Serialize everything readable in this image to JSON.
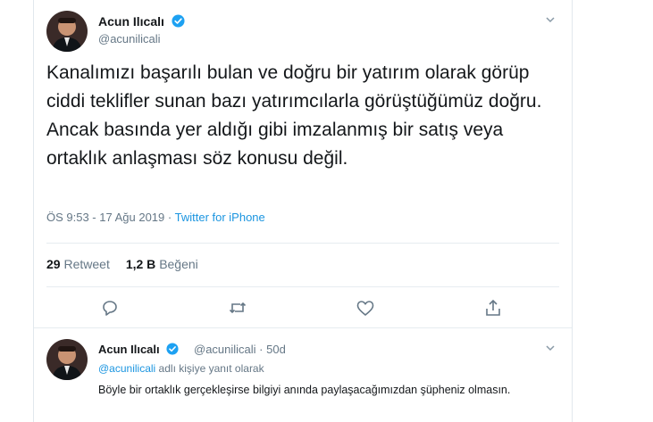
{
  "tweet": {
    "author_name": "Acun Ilıcalı",
    "author_handle": "@acunilicali",
    "text": "Kanalımızı başarılı bulan ve doğru bir yatırım olarak görüp ciddi teklifler sunan bazı yatırımcılarla görüştüğümüz doğru. Ancak basında yer aldığı gibi imzalanmış bir satış veya ortaklık anlaşması söz konusu değil.",
    "timestamp": "ÖS 9:53 - 17 Ağu 2019",
    "separator": " · ",
    "source": "Twitter for iPhone",
    "retweets_count": "29",
    "retweets_label": "Retweet",
    "likes_count": "1,2 B",
    "likes_label": "Beğeni"
  },
  "actions": [
    {
      "icon": "reply-icon"
    },
    {
      "icon": "retweet-icon"
    },
    {
      "icon": "like-icon"
    },
    {
      "icon": "share-icon"
    }
  ],
  "reply": {
    "author_name": "Acun Ilıcalı",
    "author_handle": "@acunilicali",
    "time_sep": " · ",
    "time": "50d",
    "replying_to_handle": "@acunilicali",
    "replying_to_suffix": " adlı kişiye yanıt olarak",
    "text": "Böyle bir ortaklık gerçekleşirse bilgiyi anında paylaşacağımızdan şüpheniz olmasın."
  },
  "colors": {
    "link": "#1b95e0",
    "verified": "#1da1f2",
    "muted": "#657786",
    "divider": "#e6ecf0"
  }
}
